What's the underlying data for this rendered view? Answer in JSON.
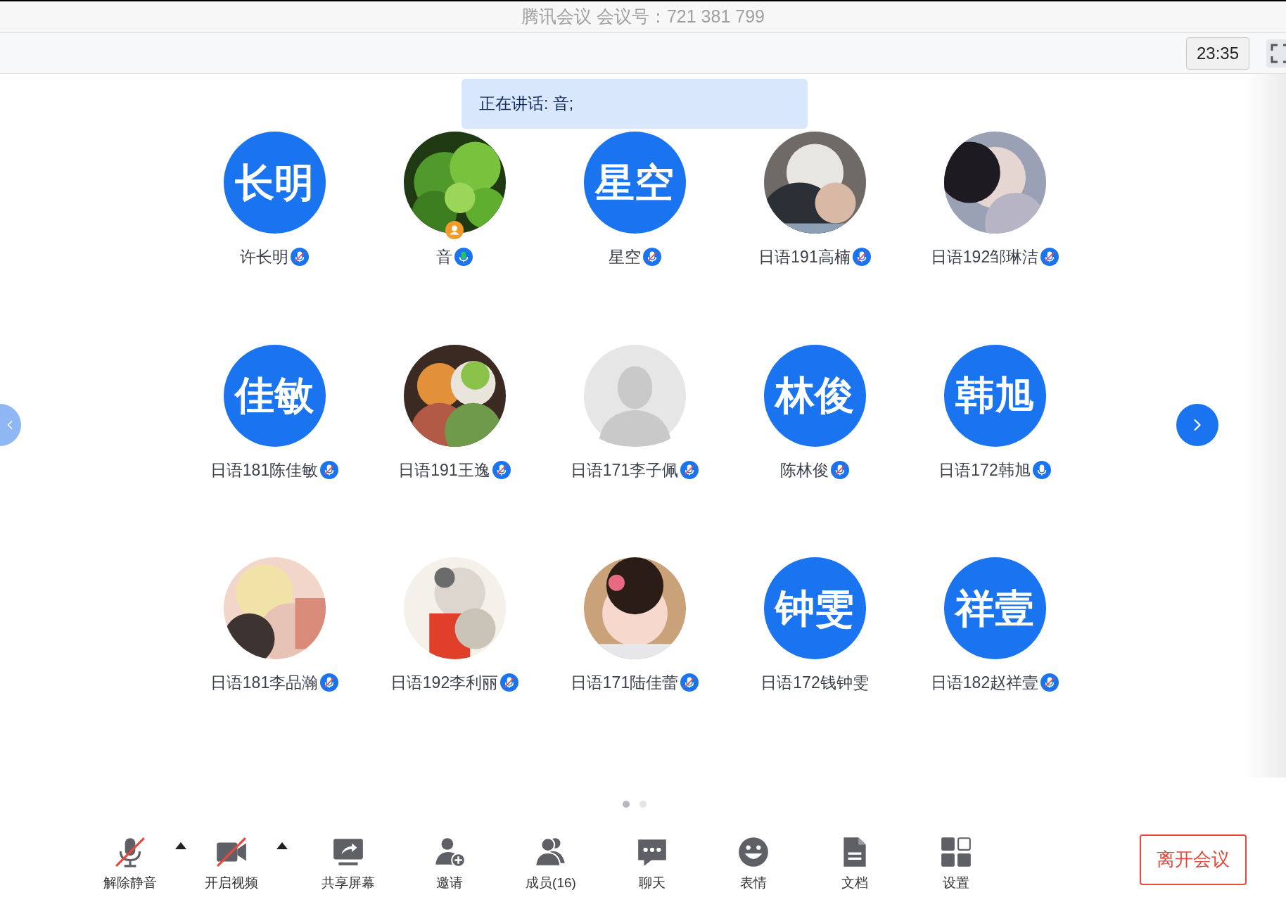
{
  "window": {
    "title": "腾讯会议 会议号：721 381 799"
  },
  "clock": "23:35",
  "speaking_banner": "正在讲话: 音;",
  "participants": [
    {
      "name": "许长明",
      "avatar": {
        "kind": "text",
        "text": "长明"
      },
      "mic_shown": true,
      "muted": true,
      "speaking": false,
      "host": false
    },
    {
      "name": "音",
      "mic_shown": true,
      "muted": false,
      "speaking": true,
      "host": true
    },
    {
      "name": "星空",
      "avatar": {
        "kind": "text",
        "text": "星空"
      },
      "mic_shown": true,
      "muted": true,
      "speaking": false,
      "host": false
    },
    {
      "name": "日语191高楠",
      "mic_shown": true,
      "muted": true,
      "speaking": false,
      "host": false
    },
    {
      "name": "日语192邹琳洁",
      "mic_shown": true,
      "muted": true,
      "speaking": false,
      "host": false
    },
    {
      "name": "日语181陈佳敏",
      "avatar": {
        "kind": "text",
        "text": "佳敏"
      },
      "mic_shown": true,
      "muted": true,
      "speaking": false,
      "host": false
    },
    {
      "name": "日语191王逸",
      "mic_shown": true,
      "muted": true,
      "speaking": false,
      "host": false
    },
    {
      "name": "日语171李子佩",
      "avatar": {
        "kind": "placeholder"
      },
      "mic_shown": true,
      "muted": true,
      "speaking": false,
      "host": false
    },
    {
      "name": "陈林俊",
      "avatar": {
        "kind": "text",
        "text": "林俊"
      },
      "mic_shown": true,
      "muted": true,
      "speaking": false,
      "host": false
    },
    {
      "name": "日语172韩旭",
      "avatar": {
        "kind": "text",
        "text": "韩旭"
      },
      "mic_shown": true,
      "muted": false,
      "speaking": false,
      "host": false
    },
    {
      "name": "日语181李品瀚",
      "mic_shown": true,
      "muted": true,
      "speaking": false,
      "host": false
    },
    {
      "name": "日语192李利丽",
      "mic_shown": true,
      "muted": true,
      "speaking": false,
      "host": false
    },
    {
      "name": "日语171陆佳蕾",
      "mic_shown": true,
      "muted": true,
      "speaking": false,
      "host": false
    },
    {
      "name": "日语172钱钟雯",
      "avatar": {
        "kind": "text",
        "text": "钟雯"
      },
      "mic_shown": false,
      "host": false
    },
    {
      "name": "日语182赵祥壹",
      "avatar": {
        "kind": "text",
        "text": "祥壹"
      },
      "mic_shown": true,
      "muted": true,
      "speaking": false,
      "host": false
    }
  ],
  "pagination": [
    {
      "selected": true
    },
    {
      "selected": false
    }
  ],
  "toolbar": [
    {
      "kind": "mic",
      "label": "解除静音",
      "slashed": true,
      "caret": true
    },
    {
      "kind": "video",
      "label": "开启视频",
      "slashed": true,
      "caret": true
    },
    {
      "kind": "share",
      "label": "共享屏幕",
      "caret": false
    },
    {
      "kind": "invite",
      "label": "邀请",
      "caret": false
    },
    {
      "kind": "members",
      "label": "成员(16)",
      "caret": false
    },
    {
      "kind": "chat",
      "label": "聊天",
      "caret": false
    },
    {
      "kind": "emoji",
      "label": "表情",
      "caret": false
    },
    {
      "kind": "docs",
      "label": "文档",
      "caret": false
    },
    {
      "kind": "settings",
      "label": "设置",
      "caret": false
    }
  ],
  "leave_button": "离开会议"
}
